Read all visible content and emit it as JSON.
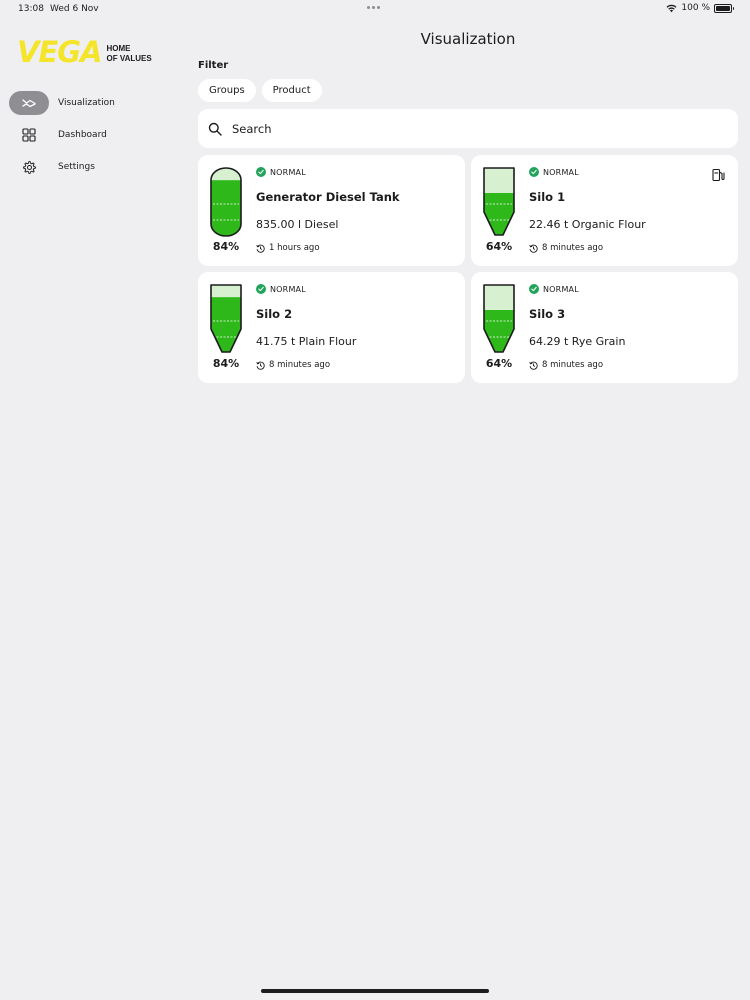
{
  "status_bar": {
    "time": "13:08",
    "date": "Wed 6 Nov",
    "battery": "100 %"
  },
  "brand": {
    "name": "VEGA",
    "tagline_line1": "HOME",
    "tagline_line2": "OF VALUES"
  },
  "sidebar": {
    "items": [
      {
        "label": "Visualization",
        "icon": "visualization-icon",
        "active": true
      },
      {
        "label": "Dashboard",
        "icon": "dashboard-icon",
        "active": false
      },
      {
        "label": "Settings",
        "icon": "gear-icon",
        "active": false
      }
    ]
  },
  "main": {
    "title": "Visualization",
    "filter_label": "Filter",
    "chips": [
      "Groups",
      "Product"
    ],
    "search_placeholder": "Search"
  },
  "cards": [
    {
      "status": "NORMAL",
      "name": "Generator Diesel Tank",
      "value": "835.00 l Diesel",
      "time": "1 hours ago",
      "percent": "84%",
      "fill": 0.84,
      "tank_shape": "rounded",
      "icon": "fuel-pump-icon"
    },
    {
      "status": "NORMAL",
      "name": "Silo 1",
      "value": "22.46 t Organic Flour",
      "time": "8 minutes ago",
      "percent": "64%",
      "fill": 0.64,
      "tank_shape": "silo",
      "icon": "fuel-pump-icon"
    },
    {
      "status": "NORMAL",
      "name": "Silo 2",
      "value": "41.75 t Plain Flour",
      "time": "8 minutes ago",
      "percent": "84%",
      "fill": 0.84,
      "tank_shape": "silo"
    },
    {
      "status": "NORMAL",
      "name": "Silo 3",
      "value": "64.29 t Rye Grain",
      "time": "8 minutes ago",
      "percent": "64%",
      "fill": 0.64,
      "tank_shape": "silo"
    }
  ],
  "colors": {
    "fill_green": "#2eb81a",
    "empty_green": "#d6f0d0",
    "status_green": "#22a35a",
    "brand_yellow": "#f5e52a"
  }
}
